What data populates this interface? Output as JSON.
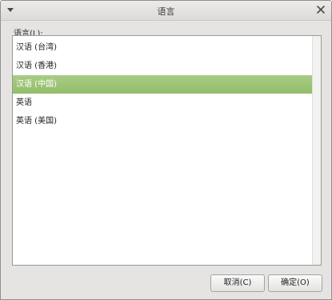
{
  "window": {
    "title": "语言"
  },
  "list": {
    "label": "语言(L):",
    "items": [
      {
        "label": "汉语 (台湾)"
      },
      {
        "label": "汉语 (香港)"
      },
      {
        "label": "汉语 (中国)",
        "selected": true
      },
      {
        "label": "英语"
      },
      {
        "label": "英语 (美国)"
      }
    ]
  },
  "buttons": {
    "cancel": "取消(C)",
    "ok": "确定(O)"
  },
  "colors": {
    "selection": "#9fc67a",
    "dialog_bg": "#e5e4e2"
  },
  "icons": {
    "menu": "chevron-down-icon",
    "close": "close-icon"
  }
}
